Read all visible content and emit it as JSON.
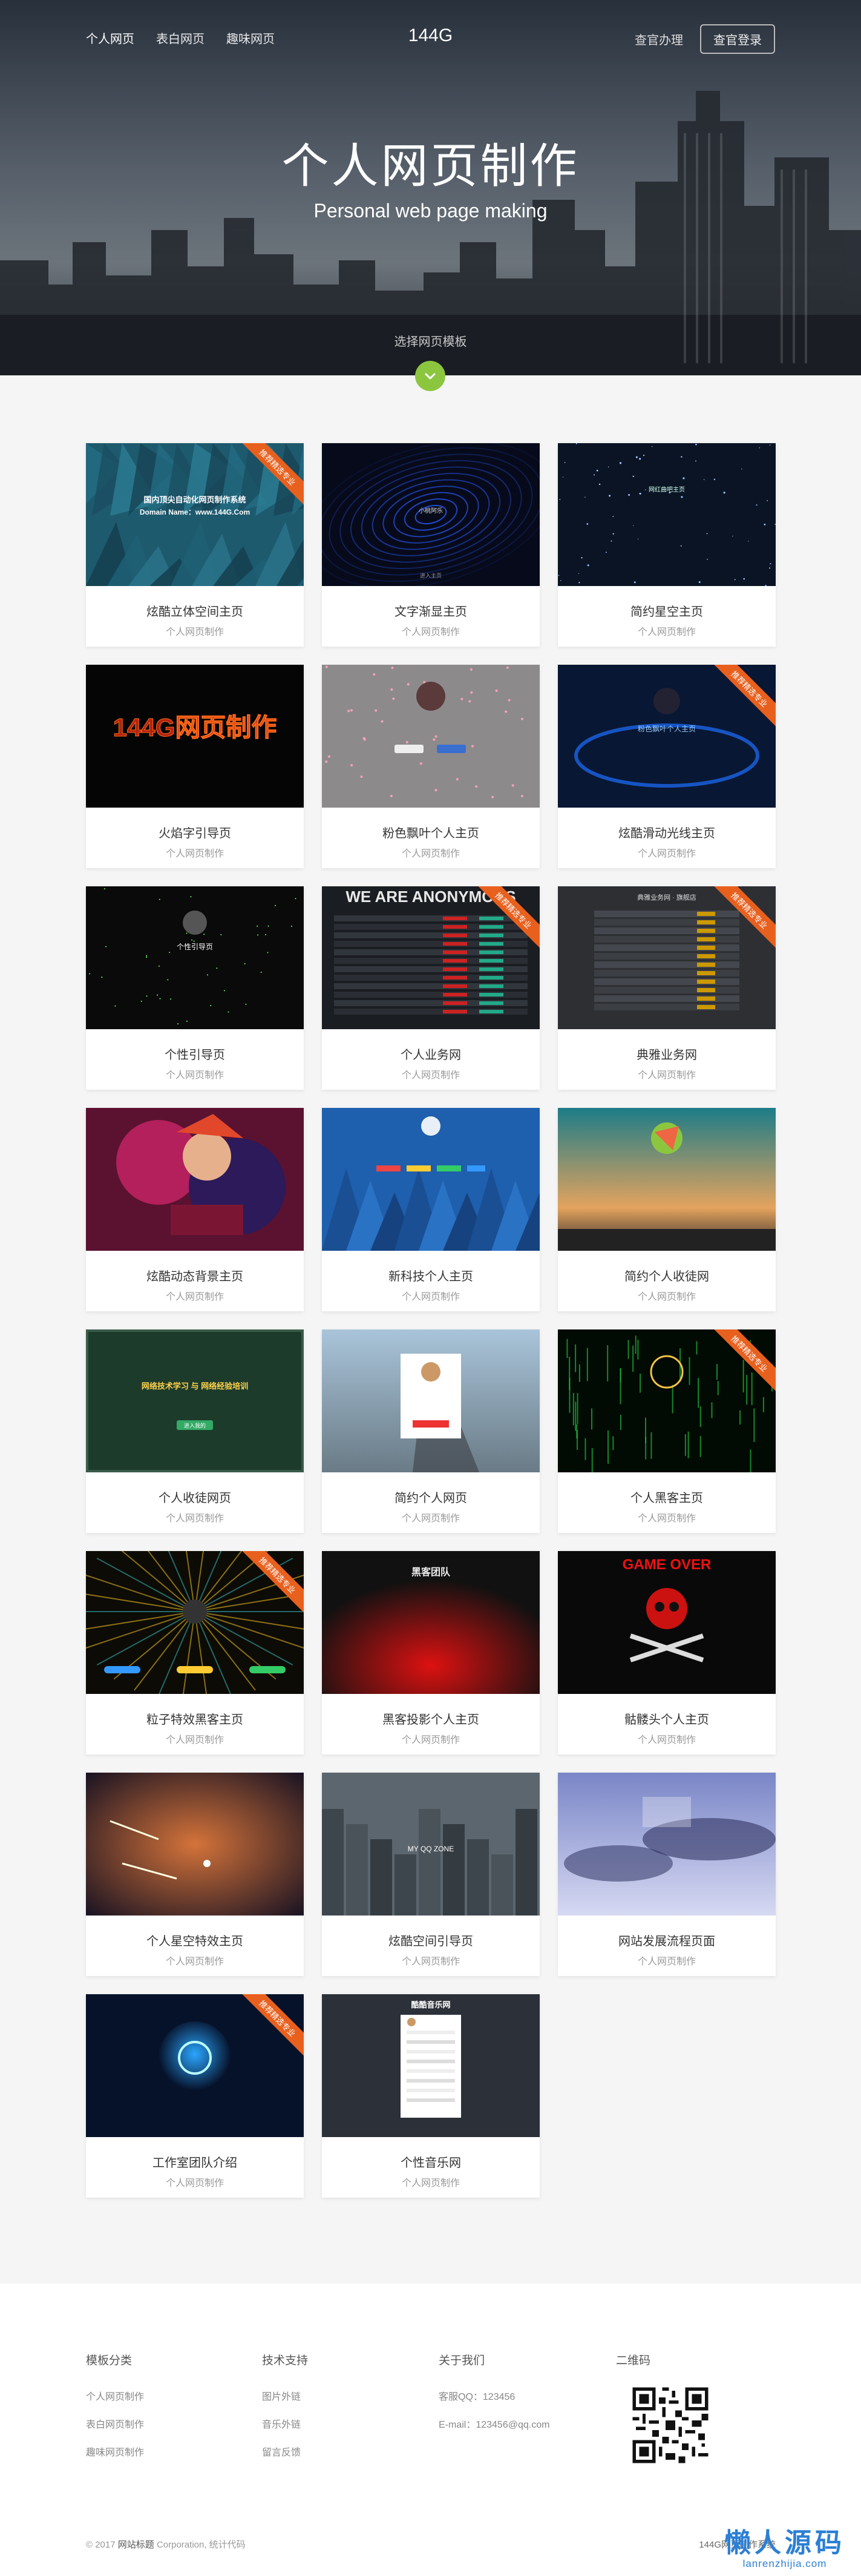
{
  "nav": {
    "links": [
      "个人网页",
      "表白网页",
      "趣味网页"
    ],
    "logo": "144G",
    "right_link": "查官办理",
    "login": "查官登录"
  },
  "hero": {
    "title": "个人网页制作",
    "subtitle": "Personal web page making",
    "hint": "选择网页模板"
  },
  "ribbon_text": "推荐精选专业",
  "cards": [
    {
      "name": "炫酷立体空间主页",
      "category": "个人网页制作",
      "featured": true,
      "theme": "polygon-teal",
      "thumb_text": "国内顶尖自动化网页制作系统",
      "thumb_text2": "Domain Name：www.144G.Com"
    },
    {
      "name": "文字渐显主页",
      "category": "个人网页制作",
      "featured": false,
      "theme": "swirl-blue",
      "thumb_text": "小桃阿乐",
      "thumb_text2": "进入主页"
    },
    {
      "name": "简约星空主页",
      "category": "个人网页制作",
      "featured": false,
      "theme": "stars",
      "thumb_text": "网红曲吧主页",
      "thumb_text2": ""
    },
    {
      "name": "火焰字引导页",
      "category": "个人网页制作",
      "featured": false,
      "theme": "fire",
      "thumb_text": "144G网页制作",
      "thumb_text2": ""
    },
    {
      "name": "粉色飘叶个人主页",
      "category": "个人网页制作",
      "featured": false,
      "theme": "pink-leaf",
      "thumb_text": "",
      "thumb_text2": ""
    },
    {
      "name": "炫酷滑动光线主页",
      "category": "个人网页制作",
      "featured": true,
      "theme": "ring-blue",
      "thumb_text": "粉色飘叶个人主页",
      "thumb_text2": ""
    },
    {
      "name": "个性引导页",
      "category": "个人网页制作",
      "featured": false,
      "theme": "dark-guide",
      "thumb_text": "个性引导页",
      "thumb_text2": ""
    },
    {
      "name": "个人业务网",
      "category": "个人网页制作",
      "featured": true,
      "theme": "anon",
      "thumb_text": "WE ARE ANONYMOUS",
      "thumb_text2": ""
    },
    {
      "name": "典雅业务网",
      "category": "个人网页制作",
      "featured": true,
      "theme": "table-dark",
      "thumb_text": "典雅业务网 · 旗舰店",
      "thumb_text2": ""
    },
    {
      "name": "炫酷动态背景主页",
      "category": "个人网页制作",
      "featured": false,
      "theme": "anime",
      "thumb_text": "",
      "thumb_text2": ""
    },
    {
      "name": "新科技个人主页",
      "category": "个人网页制作",
      "featured": false,
      "theme": "tech-blue",
      "thumb_text": "",
      "thumb_text2": ""
    },
    {
      "name": "简约个人收徒网",
      "category": "个人网页制作",
      "featured": false,
      "theme": "sunset",
      "thumb_text": "",
      "thumb_text2": ""
    },
    {
      "name": "个人收徒网页",
      "category": "个人网页制作",
      "featured": false,
      "theme": "chalkboard",
      "thumb_text": "网络技术学习 与 网络经验培训",
      "thumb_text2": "进入我的"
    },
    {
      "name": "简约个人网页",
      "category": "个人网页制作",
      "featured": false,
      "theme": "pier",
      "thumb_text": "",
      "thumb_text2": ""
    },
    {
      "name": "个人黑客主页",
      "category": "个人网页制作",
      "featured": true,
      "theme": "matrix",
      "thumb_text": "",
      "thumb_text2": ""
    },
    {
      "name": "粒子特效黑客主页",
      "category": "个人网页制作",
      "featured": true,
      "theme": "particles",
      "thumb_text": "",
      "thumb_text2": ""
    },
    {
      "name": "黑客投影个人主页",
      "category": "个人网页制作",
      "featured": false,
      "theme": "red-glow",
      "thumb_text": "黑客团队",
      "thumb_text2": ""
    },
    {
      "name": "骷髅头个人主页",
      "category": "个人网页制作",
      "featured": false,
      "theme": "skull",
      "thumb_text": "GAME OVER",
      "thumb_text2": ""
    },
    {
      "name": "个人星空特效主页",
      "category": "个人网页制作",
      "featured": false,
      "theme": "space",
      "thumb_text": "",
      "thumb_text2": ""
    },
    {
      "name": "炫酷空间引导页",
      "category": "个人网页制作",
      "featured": false,
      "theme": "city-grey",
      "thumb_text": "MY QQ ZONE",
      "thumb_text2": ""
    },
    {
      "name": "网站发展流程页面",
      "category": "个人网页制作",
      "featured": false,
      "theme": "clouds",
      "thumb_text": "",
      "thumb_text2": ""
    },
    {
      "name": "工作室团队介绍",
      "category": "个人网页制作",
      "featured": true,
      "theme": "glow-logo",
      "thumb_text": "",
      "thumb_text2": ""
    },
    {
      "name": "个性音乐网",
      "category": "个人网页制作",
      "featured": false,
      "theme": "music",
      "thumb_text": "酷酷音乐网",
      "thumb_text2": ""
    }
  ],
  "footer": {
    "col1": {
      "title": "模板分类",
      "links": [
        "个人网页制作",
        "表白网页制作",
        "趣味网页制作"
      ]
    },
    "col2": {
      "title": "技术支持",
      "links": [
        "图片外链",
        "音乐外链",
        "留言反馈"
      ]
    },
    "col3": {
      "title": "关于我们",
      "lines": [
        "客服QQ：123456",
        "E-mail：123456@qq.com"
      ]
    },
    "col4": {
      "title": "二维码"
    },
    "copyright": "© 2017",
    "site_name": "网站标题",
    "copyright_rest": "Corporation, 统计代码",
    "system": "144G网页制作系统"
  },
  "watermark": {
    "line1": "懒人源码",
    "line2": "lanrenzhijia.com"
  },
  "colors": {
    "accent_green": "#8cc63f",
    "ribbon": "#e8601e",
    "watermark": "#2b7fd4"
  }
}
